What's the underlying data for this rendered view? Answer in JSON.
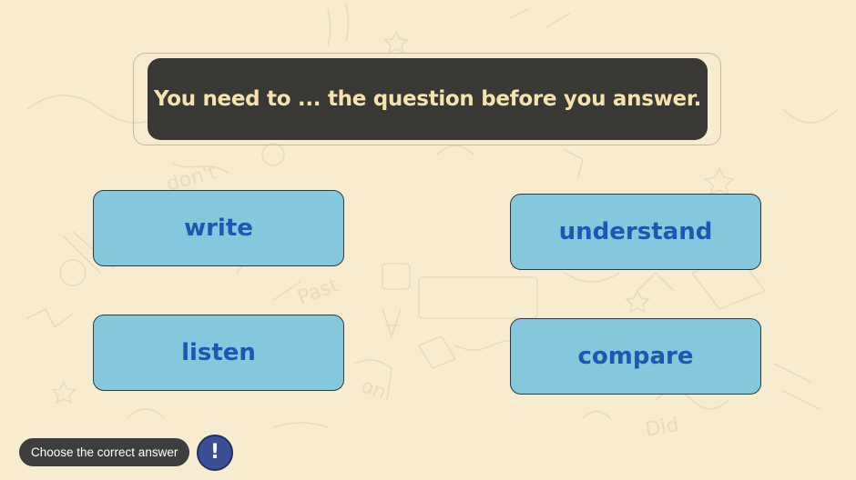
{
  "question": {
    "text": "You need to ... the question before you answer."
  },
  "answers": [
    {
      "label": "write"
    },
    {
      "label": "understand"
    },
    {
      "label": "listen"
    },
    {
      "label": "compare"
    }
  ],
  "hint": {
    "label": "Choose the correct answer",
    "button_icon": "!"
  },
  "colors": {
    "background": "#f7ebd0",
    "question_card": "#393835",
    "question_text": "#f6e2ad",
    "answer_fill": "#85c8dd",
    "answer_text": "#1a58b3",
    "hint_button": "#3a4f96"
  }
}
